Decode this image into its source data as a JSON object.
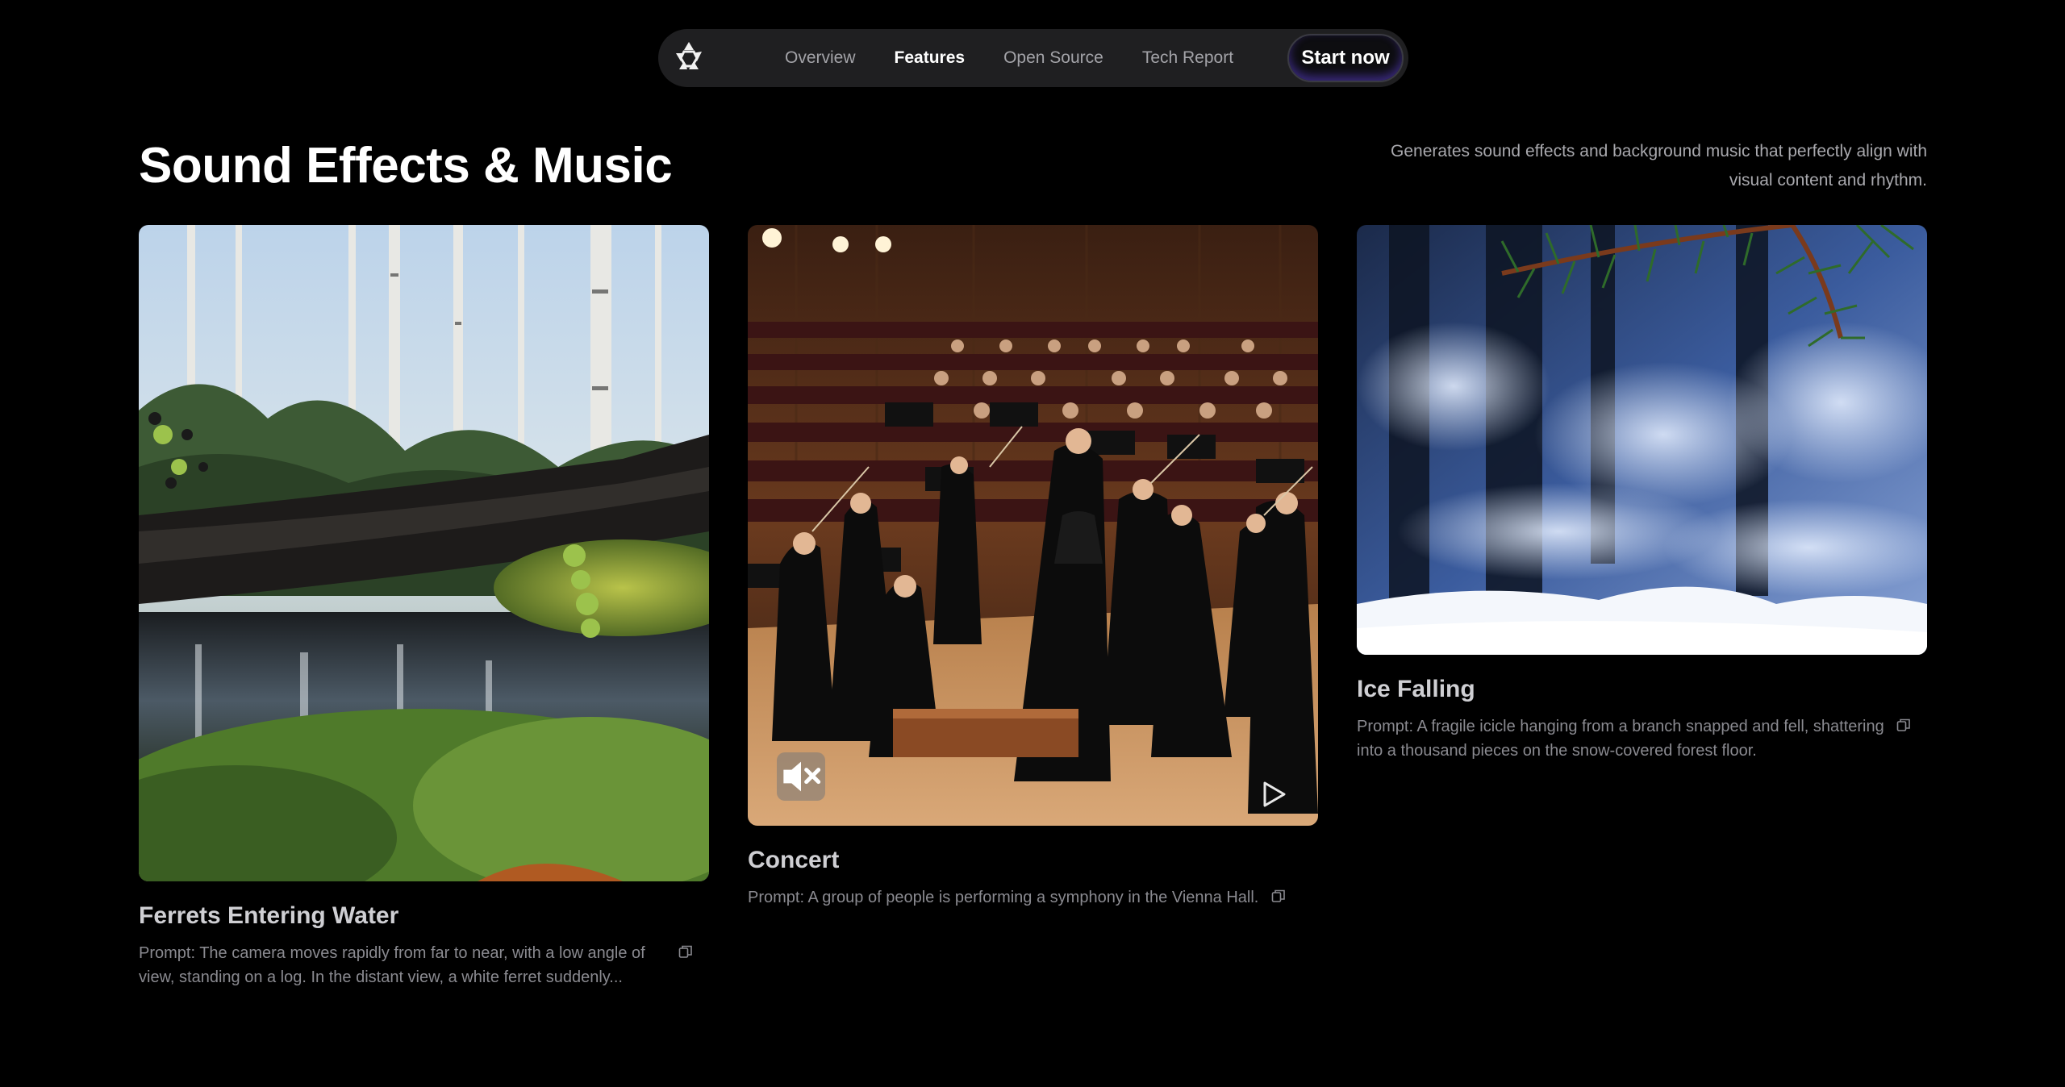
{
  "nav": {
    "logo_icon": "logo-icon",
    "links": [
      {
        "label": "Overview",
        "active": false
      },
      {
        "label": "Features",
        "active": true
      },
      {
        "label": "Open Source",
        "active": false
      },
      {
        "label": "Tech Report",
        "active": false
      }
    ],
    "cta_label": "Start now"
  },
  "section": {
    "title": "Sound Effects & Music",
    "description": "Generates sound effects and background music that perfectly align with visual content and rhythm."
  },
  "cards": [
    {
      "title": "Ferrets Entering Water",
      "prompt": "Prompt: The camera moves rapidly from far to near, with a low angle of view, standing on a log. In the distant view, a white ferret suddenly...",
      "image_icon": "forest-pond-image",
      "copy_icon": "copy-icon"
    },
    {
      "title": "Concert",
      "prompt": "Prompt: A group of people is performing a symphony in the Vienna Hall.",
      "image_icon": "orchestra-image",
      "copy_icon": "copy-icon",
      "mute_icon": "muted-speaker-icon",
      "play_icon": "play-icon"
    },
    {
      "title": "Ice Falling",
      "prompt": "Prompt: A fragile icicle hanging from a branch snapped and fell, shattering into a thousand pieces on the snow-covered forest floor.",
      "image_icon": "snowy-forest-image",
      "copy_icon": "copy-icon"
    }
  ],
  "colors": {
    "background": "#000000",
    "nav_bg": "#1f1f21",
    "cta_glow": "#6f4cff",
    "muted_text": "#8a8a90"
  }
}
